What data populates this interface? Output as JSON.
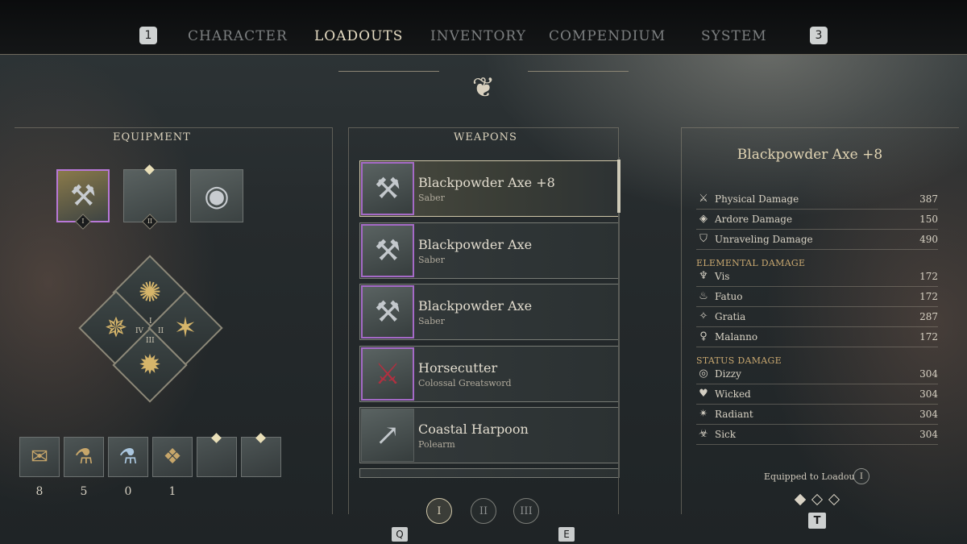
{
  "nav": {
    "left_key": "1",
    "right_key": "3",
    "tabs": [
      "CHARACTER",
      "LOADOUTS",
      "INVENTORY",
      "COMPENDIUM",
      "SYSTEM"
    ],
    "active_tab": "LOADOUTS"
  },
  "equipment": {
    "title": "EQUIPMENT",
    "slot_marks": [
      "I",
      "II"
    ],
    "rune_marks": [
      "I",
      "II",
      "III",
      "IV"
    ],
    "consumables": [
      {
        "icon": "scroll-icon",
        "count": "8"
      },
      {
        "icon": "potion-orange-icon",
        "count": "5"
      },
      {
        "icon": "potion-blue-icon",
        "count": "0"
      },
      {
        "icon": "wrapped-bundle-icon",
        "count": "1"
      }
    ]
  },
  "weapons": {
    "title": "WEAPONS",
    "items": [
      {
        "name": "Blackpowder Axe +8",
        "type": "Saber",
        "selected": true
      },
      {
        "name": "Blackpowder Axe",
        "type": "Saber",
        "selected": false
      },
      {
        "name": "Blackpowder Axe",
        "type": "Saber",
        "selected": false
      },
      {
        "name": "Horsecutter",
        "type": "Colossal Greatsword",
        "selected": false
      },
      {
        "name": "Coastal Harpoon",
        "type": "Polearm",
        "selected": false
      }
    ],
    "pages": [
      "I",
      "II",
      "III"
    ],
    "active_page": "I",
    "prev_key": "Q",
    "next_key": "E"
  },
  "stats": {
    "title": "Blackpowder Axe +8",
    "damage": [
      {
        "icon": "sword-icon",
        "label": "Physical Damage",
        "value": "387"
      },
      {
        "icon": "ardore-icon",
        "label": "Ardore Damage",
        "value": "150"
      },
      {
        "icon": "shield-crack-icon",
        "label": "Unraveling Damage",
        "value": "490"
      }
    ],
    "elemental_title": "ELEMENTAL DAMAGE",
    "elemental": [
      {
        "icon": "chalice-icon",
        "label": "Vis",
        "value": "172"
      },
      {
        "icon": "flame-icon",
        "label": "Fatuo",
        "value": "172"
      },
      {
        "icon": "radiance-icon",
        "label": "Gratia",
        "value": "287"
      },
      {
        "icon": "skull-pin-icon",
        "label": "Malanno",
        "value": "172"
      }
    ],
    "status_title": "STATUS DAMAGE",
    "status": [
      {
        "icon": "spiral-icon",
        "label": "Dizzy",
        "value": "304"
      },
      {
        "icon": "broken-heart-icon",
        "label": "Wicked",
        "value": "304"
      },
      {
        "icon": "starburst-icon",
        "label": "Radiant",
        "value": "304"
      },
      {
        "icon": "sick-icon",
        "label": "Sick",
        "value": "304"
      }
    ],
    "equipped_label": "Equipped to Loadout",
    "equipped_num": "I",
    "toggle_key": "T"
  }
}
